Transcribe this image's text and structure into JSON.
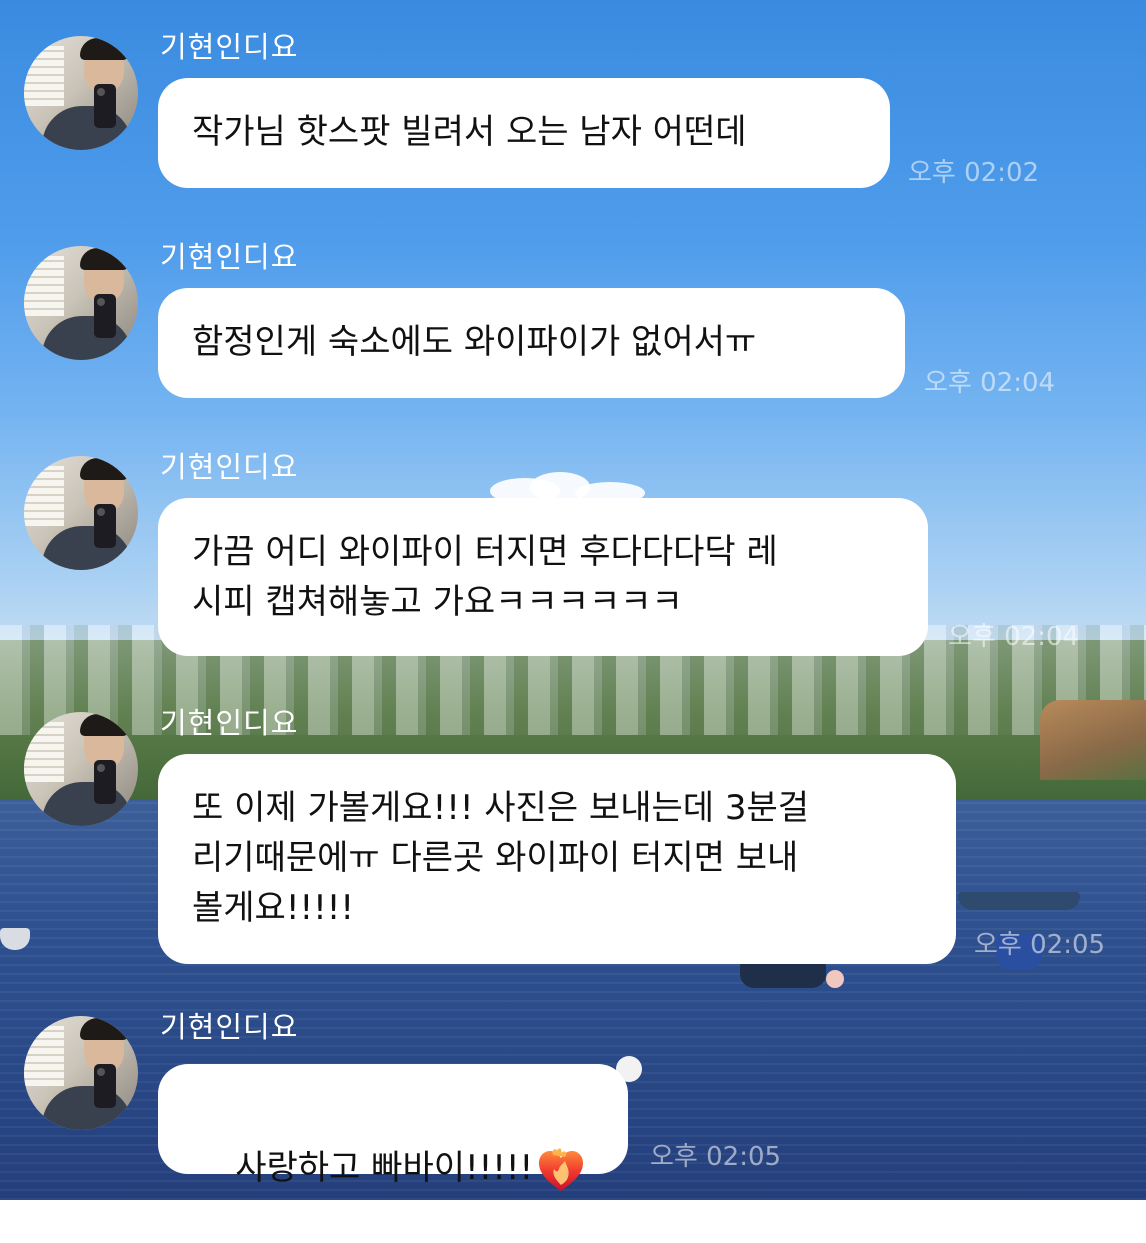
{
  "colors": {
    "bubble": "#ffffff",
    "sender_name": "#ffffff",
    "timestamp": "rgba(255,255,255,0.55)"
  },
  "messages": [
    {
      "sender": "기현인디요",
      "text": "작가님 핫스팟 빌려서 오는 남자 어떤데",
      "time": "오후 02:02"
    },
    {
      "sender": "기현인디요",
      "text": "함정인게 숙소에도 와이파이가 없어서ㅠ",
      "time": "오후 02:04"
    },
    {
      "sender": "기현인디요",
      "text": "가끔 어디 와이파이 터지면 후다다다닥 레\n시피 캡쳐해놓고 가요ㅋㅋㅋㅋㅋㅋ",
      "time": "오후 02:04"
    },
    {
      "sender": "기현인디요",
      "text": "또 이제 가볼게요!!! 사진은 보내는데 3분걸\n리기때문에ㅠ 다른곳 와이파이 터지면 보내\n볼게요!!!!!",
      "time": "오후 02:05"
    },
    {
      "sender": "기현인디요",
      "text": "사랑하고 빠바이!!!!!",
      "emoji": "heart-on-fire",
      "time": "오후 02:05"
    }
  ]
}
